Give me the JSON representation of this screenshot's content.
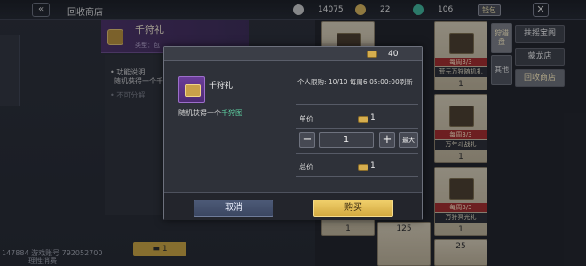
{
  "header": {
    "back_icon": "double-chevron-left-icon",
    "title": "回收商店",
    "resources": [
      {
        "icon": "silver-ingot-icon",
        "value": "14075",
        "color": "#c9c9c9"
      },
      {
        "icon": "gold-leaf-icon",
        "value": "22",
        "color": "#d8b45a"
      },
      {
        "icon": "jade-feather-icon",
        "value": "106",
        "color": "#3fb59a"
      }
    ],
    "tag_label": "钱包",
    "close_icon": "close-icon"
  },
  "info_panel": {
    "title": "千狩礼",
    "type_label": "类型：包",
    "function_label": "• 功能说明",
    "function_desc": "随机获得一个千狩",
    "no_split": "• 不可分解",
    "bottom_count": "1"
  },
  "footer": {
    "uid": "147884 游戏账号 792052700",
    "notice": "理性消费"
  },
  "shop": {
    "cells": [
      {
        "limit": "",
        "name": "",
        "price": ""
      },
      {
        "limit": "每周3/3",
        "name": "荒元万狩随机礼",
        "price": "1"
      },
      {
        "limit": "",
        "name": "",
        "price": ""
      },
      {
        "limit": "每周3/3",
        "name": "万年斗战礼",
        "price": "1"
      },
      {
        "limit": "",
        "name": "",
        "price": "1"
      },
      {
        "limit": "每周3/3",
        "name": "万狩冥光礼",
        "price": "1"
      },
      {
        "limit": "",
        "name": "",
        "price": "125"
      },
      {
        "limit": "",
        "name": "",
        "price": "25"
      }
    ],
    "side_tabs": [
      {
        "label": "狩猎盘",
        "active": true
      },
      {
        "label": "其他",
        "active": false
      }
    ],
    "shop_tabs": [
      {
        "label": "扶摇宝阁",
        "active": false
      },
      {
        "label": "蒙龙店",
        "active": false
      },
      {
        "label": "回收商店",
        "active": true
      }
    ]
  },
  "modal": {
    "coin_balance": "40",
    "item_name": "千狩礼",
    "item_desc_prefix": "随机获得一个",
    "item_desc_highlight": "千狩图",
    "purchase_limit": "个人限购: 10/10 每周6 05:00:00刷新",
    "unit_price_label": "单价",
    "unit_price_value": "1",
    "quantity": "1",
    "max_label": "最大",
    "total_label": "总价",
    "total_value": "1",
    "cancel_label": "取消",
    "buy_label": "购买",
    "minus_icon": "minus-icon",
    "plus_icon": "plus-icon",
    "coin_icon": "gold-ingot-icon"
  }
}
